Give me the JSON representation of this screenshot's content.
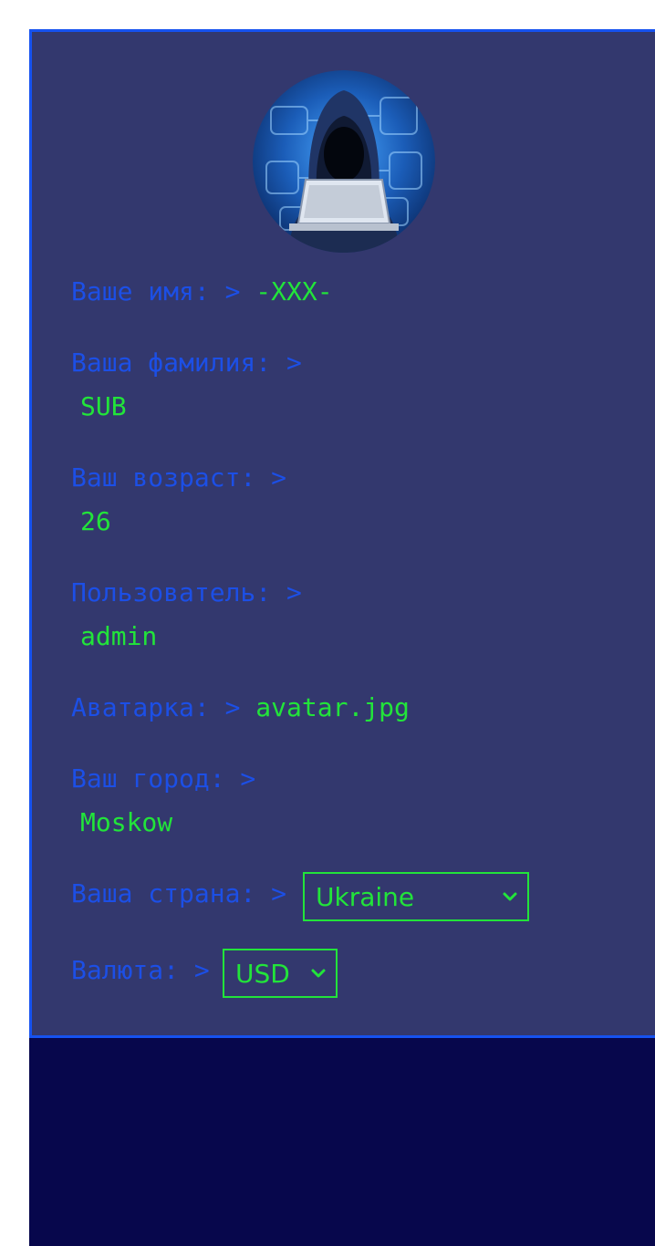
{
  "profile": {
    "avatar_alt": "",
    "first_name": {
      "label": "Ваше имя: >",
      "value": "-XXX-"
    },
    "last_name": {
      "label": "Ваша фамилия: >",
      "value": "SUB"
    },
    "age": {
      "label": "Ваш возраст: >",
      "value": "26"
    },
    "user": {
      "label": "Пользователь: >",
      "value": "admin"
    },
    "avatar_file": {
      "label": "Аватарка: >",
      "value": "avatar.jpg"
    },
    "city": {
      "label": "Ваш город: >",
      "value": "Moskow"
    },
    "country": {
      "label": "Ваша страна: >",
      "selected": "Ukraine"
    },
    "currency": {
      "label": "Валюта: >",
      "selected": "USD"
    }
  },
  "colors": {
    "card_background": "#33386e",
    "card_border": "#1652f0",
    "label": "#1c4fe6",
    "value": "#22e43a",
    "footer_background": "#07074c"
  },
  "icons": {
    "avatar": "hooded-hacker-avatar-icon",
    "select_arrow": "chevron-down-icon"
  }
}
